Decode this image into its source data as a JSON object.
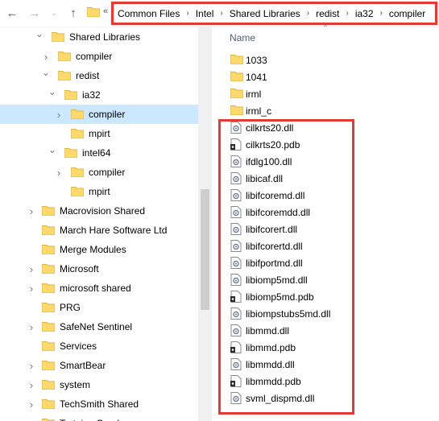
{
  "nav": {
    "back_icon": "arrow-left-icon",
    "forward_icon": "arrow-right-icon",
    "recent_icon": "chevron-down-icon",
    "up_icon": "arrow-up-icon",
    "overflow": "«"
  },
  "breadcrumb": [
    "Common Files",
    "Intel",
    "Shared Libraries",
    "redist",
    "ia32",
    "compiler"
  ],
  "tree": [
    {
      "label": "Shared Libraries",
      "level": 1,
      "state": "expanded",
      "selected": false
    },
    {
      "label": "compiler",
      "level": 2,
      "state": "collapsed",
      "selected": false
    },
    {
      "label": "redist",
      "level": 2,
      "state": "expanded",
      "selected": false
    },
    {
      "label": "ia32",
      "level": 3,
      "state": "expanded",
      "selected": false
    },
    {
      "label": "compiler",
      "level": 4,
      "state": "collapsed",
      "selected": true
    },
    {
      "label": "mpirt",
      "level": 4,
      "state": "none",
      "selected": false
    },
    {
      "label": "intel64",
      "level": 3,
      "state": "expanded",
      "selected": false
    },
    {
      "label": "compiler",
      "level": 4,
      "state": "collapsed",
      "selected": false
    },
    {
      "label": "mpirt",
      "level": 4,
      "state": "none",
      "selected": false
    },
    {
      "label": "Macrovision Shared",
      "level": 0,
      "state": "collapsed",
      "selected": false
    },
    {
      "label": "March Hare Software Ltd",
      "level": 0,
      "state": "none",
      "selected": false
    },
    {
      "label": "Merge Modules",
      "level": 0,
      "state": "none",
      "selected": false
    },
    {
      "label": "Microsoft",
      "level": 0,
      "state": "collapsed",
      "selected": false
    },
    {
      "label": "microsoft shared",
      "level": 0,
      "state": "collapsed",
      "selected": false
    },
    {
      "label": "PRG",
      "level": 0,
      "state": "none",
      "selected": false
    },
    {
      "label": "SafeNet Sentinel",
      "level": 0,
      "state": "collapsed",
      "selected": false
    },
    {
      "label": "Services",
      "level": 0,
      "state": "none",
      "selected": false
    },
    {
      "label": "SmartBear",
      "level": 0,
      "state": "collapsed",
      "selected": false
    },
    {
      "label": "system",
      "level": 0,
      "state": "collapsed",
      "selected": false
    },
    {
      "label": "TechSmith Shared",
      "level": 0,
      "state": "collapsed",
      "selected": false
    },
    {
      "label": "Tortoise Overlays",
      "level": 0,
      "state": "collapsed",
      "selected": false
    }
  ],
  "list": {
    "column_name": "Name",
    "items": [
      {
        "name": "1033",
        "type": "folder"
      },
      {
        "name": "1041",
        "type": "folder"
      },
      {
        "name": "irml",
        "type": "folder"
      },
      {
        "name": "irml_c",
        "type": "folder"
      },
      {
        "name": "cilkrts20.dll",
        "type": "dll"
      },
      {
        "name": "cilkrts20.pdb",
        "type": "pdb"
      },
      {
        "name": "ifdlg100.dll",
        "type": "dll"
      },
      {
        "name": "libicaf.dll",
        "type": "dll"
      },
      {
        "name": "libifcoremd.dll",
        "type": "dll"
      },
      {
        "name": "libifcoremdd.dll",
        "type": "dll"
      },
      {
        "name": "libifcorert.dll",
        "type": "dll"
      },
      {
        "name": "libifcorertd.dll",
        "type": "dll"
      },
      {
        "name": "libifportmd.dll",
        "type": "dll"
      },
      {
        "name": "libiomp5md.dll",
        "type": "dll"
      },
      {
        "name": "libiomp5md.pdb",
        "type": "pdb"
      },
      {
        "name": "libiompstubs5md.dll",
        "type": "dll"
      },
      {
        "name": "libmmd.dll",
        "type": "dll"
      },
      {
        "name": "libmmd.pdb",
        "type": "pdb"
      },
      {
        "name": "libmmdd.dll",
        "type": "dll"
      },
      {
        "name": "libmmdd.pdb",
        "type": "pdb"
      },
      {
        "name": "svml_dispmd.dll",
        "type": "dll"
      }
    ]
  },
  "colors": {
    "highlight_border": "#e53935",
    "selection_bg": "#cce8ff",
    "folder_yellow": "#ffd96b"
  }
}
